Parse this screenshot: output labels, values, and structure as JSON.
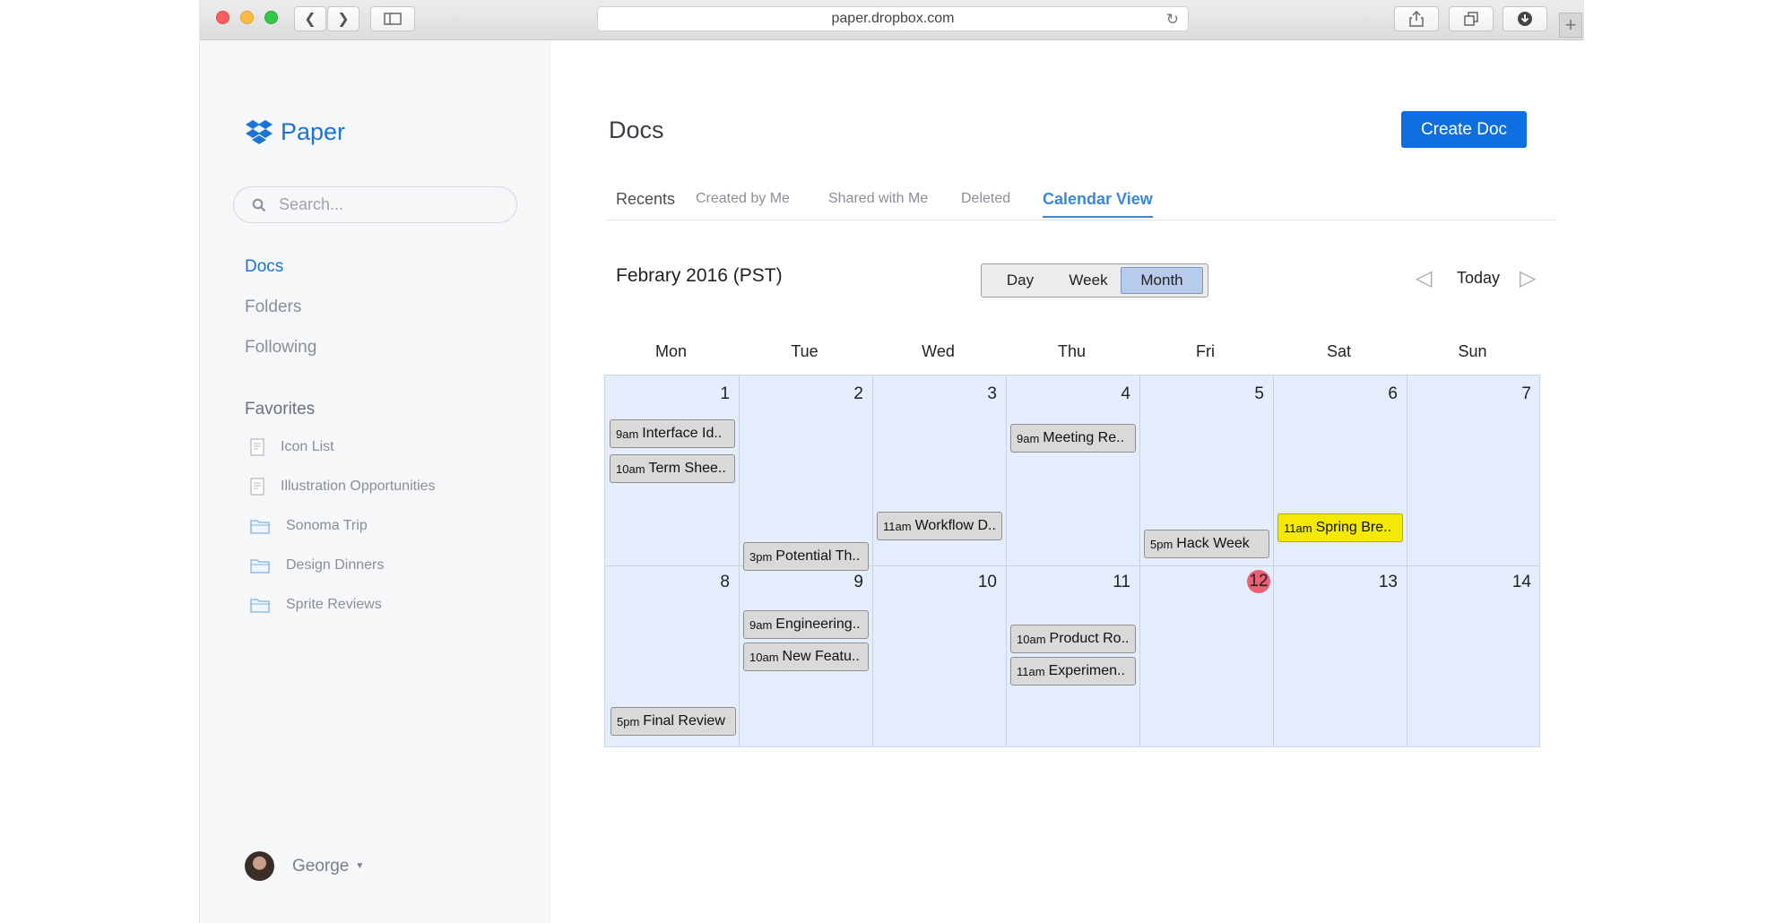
{
  "browser": {
    "url": "paper.dropbox.com"
  },
  "sidebar": {
    "brand": "Paper",
    "search_placeholder": "Search...",
    "nav": [
      {
        "label": "Docs",
        "active": true
      },
      {
        "label": "Folders",
        "active": false
      },
      {
        "label": "Following",
        "active": false
      }
    ],
    "favorites_title": "Favorites",
    "favorites": [
      {
        "label": "Icon List",
        "icon": "document-icon"
      },
      {
        "label": "Illustration Opportunities",
        "icon": "document-icon"
      },
      {
        "label": "Sonoma Trip",
        "icon": "folder-icon"
      },
      {
        "label": "Design Dinners",
        "icon": "folder-icon"
      },
      {
        "label": "Sprite Reviews",
        "icon": "folder-icon"
      }
    ],
    "user": "George"
  },
  "main": {
    "title": "Docs",
    "create_label": "Create Doc",
    "tabs": [
      "Recents",
      "Created by Me",
      "Shared with Me",
      "Deleted",
      "Calendar View"
    ],
    "active_tab": "Calendar View"
  },
  "calendar": {
    "title": "Febrary 2016 (PST)",
    "views": [
      "Day",
      "Week",
      "Month"
    ],
    "selected_view": "Month",
    "today_label": "Today",
    "days_of_week": [
      "Mon",
      "Tue",
      "Wed",
      "Thu",
      "Fri",
      "Sat",
      "Sun"
    ],
    "weeks": [
      [
        "1",
        "2",
        "3",
        "4",
        "5",
        "6",
        "7"
      ],
      [
        "8",
        "9",
        "10",
        "11",
        "12",
        "13",
        "14"
      ]
    ],
    "today": "12",
    "events": [
      {
        "time": "9am",
        "title": "Interface Id..",
        "highlight": false
      },
      {
        "time": "10am",
        "title": "Term Shee..",
        "highlight": false
      },
      {
        "time": "3pm",
        "title": "Potential Th..",
        "highlight": false
      },
      {
        "time": "11am",
        "title": "Workflow D..",
        "highlight": false
      },
      {
        "time": "9am",
        "title": "Meeting Re..",
        "highlight": false
      },
      {
        "time": "5pm",
        "title": "Hack Week",
        "highlight": false
      },
      {
        "time": "11am",
        "title": "Spring Bre..",
        "highlight": true
      },
      {
        "time": "5pm",
        "title": "Final Review",
        "highlight": false
      },
      {
        "time": "9am",
        "title": "Engineering..",
        "highlight": false
      },
      {
        "time": "10am",
        "title": "New Featu..",
        "highlight": false
      },
      {
        "time": "10am",
        "title": "Product Ro..",
        "highlight": false
      },
      {
        "time": "11am",
        "title": "Experimen..",
        "highlight": false
      }
    ]
  },
  "colors": {
    "accent": "#0d6fe0",
    "calendar_bg": "#e4edfb",
    "highlight_event": "#f4e805",
    "today_badge": "#ea5f74"
  }
}
